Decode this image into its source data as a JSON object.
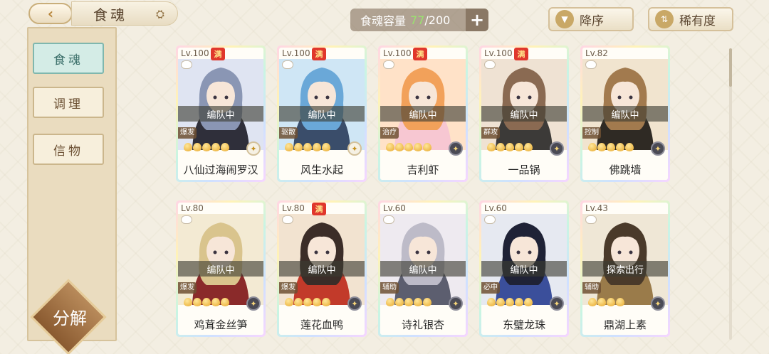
{
  "header": {
    "title": "食魂",
    "capacity_label": "食魂容量",
    "capacity_current": "77",
    "capacity_separator": "/",
    "capacity_max": "200",
    "add_label": "+",
    "sort_desc_label": "降序",
    "sort_rarity_label": "稀有度"
  },
  "sidebar": {
    "items": [
      {
        "label": "食魂",
        "active": true
      },
      {
        "label": "调理",
        "active": false
      },
      {
        "label": "信物",
        "active": false
      }
    ],
    "decompose_label": "分解"
  },
  "cards": [
    {
      "level": "Lv.100",
      "full": "满",
      "status": "编队中",
      "role": "爆发",
      "stars": 5,
      "element": "light",
      "name": "八仙过海闹罗汉",
      "palette": [
        "#dfe4f2",
        "#8a96b4",
        "#2f2f3a"
      ]
    },
    {
      "level": "Lv.100",
      "full": "满",
      "status": "编队中",
      "role": "驱散",
      "stars": 5,
      "element": "light",
      "name": "风生水起",
      "palette": [
        "#cfe6f5",
        "#6aa8d8",
        "#3a4d6a"
      ]
    },
    {
      "level": "Lv.100",
      "full": "满",
      "status": "编队中",
      "role": "治疗",
      "stars": 5,
      "element": "dark",
      "name": "吉利虾",
      "palette": [
        "#ffe2c8",
        "#f2a15a",
        "#f7c7d2"
      ]
    },
    {
      "level": "Lv.100",
      "full": "满",
      "status": "编队中",
      "role": "群攻",
      "stars": 5,
      "element": "dark",
      "name": "一品锅",
      "palette": [
        "#efe2d3",
        "#8a6a52",
        "#3c3a38"
      ]
    },
    {
      "level": "Lv.82",
      "full": "",
      "status": "编队中",
      "role": "控制",
      "stars": 5,
      "element": "dark",
      "name": "佛跳墙",
      "palette": [
        "#f1e4cf",
        "#a27a4e",
        "#2f2a24"
      ]
    },
    {
      "level": "Lv.80",
      "full": "",
      "status": "编队中",
      "role": "爆发",
      "stars": 5,
      "element": "dark",
      "name": "鸡茸金丝笋",
      "palette": [
        "#f3ead3",
        "#d9c48d",
        "#8a2a2a"
      ]
    },
    {
      "level": "Lv.80",
      "full": "满",
      "status": "编队中",
      "role": "爆发",
      "stars": 5,
      "element": "dark",
      "name": "莲花血鸭",
      "palette": [
        "#f2e3d0",
        "#3b2d28",
        "#c23a2a"
      ]
    },
    {
      "level": "Lv.60",
      "full": "",
      "status": "编队中",
      "role": "辅助",
      "stars": 5,
      "element": "dark",
      "name": "诗礼银杏",
      "palette": [
        "#eeeaf0",
        "#bdbbc8",
        "#5c5e6f"
      ]
    },
    {
      "level": "Lv.60",
      "full": "",
      "status": "编队中",
      "role": "必中",
      "stars": 5,
      "element": "dark",
      "name": "东璧龙珠",
      "palette": [
        "#e6e9f1",
        "#1f2236",
        "#3b4f9b"
      ]
    },
    {
      "level": "Lv.43",
      "full": "",
      "status": "探索出行",
      "role": "辅助",
      "stars": 4,
      "element": "dark",
      "name": "鼎湖上素",
      "palette": [
        "#efe7d6",
        "#4a3a2a",
        "#9a7b4a"
      ]
    }
  ]
}
